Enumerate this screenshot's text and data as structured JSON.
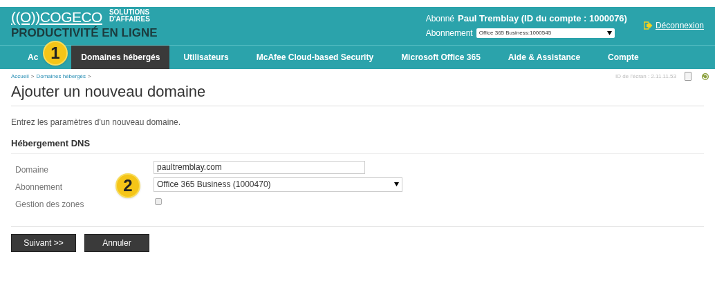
{
  "brand": {
    "logo": "((O))COGECO",
    "tagline_1": "SOLUTIONS",
    "tagline_2": "D'AFFAIRES",
    "product": "PRODUCTIVITÉ EN LIGNE"
  },
  "account": {
    "subscriber_label": "Abonné",
    "subscriber": "Paul Tremblay (ID du compte : 1000076)",
    "subscription_label": "Abonnement",
    "subscription": "Office 365 Business:1000545",
    "logout": "Déconnexion"
  },
  "nav": [
    {
      "label": "Ac",
      "selected": false
    },
    {
      "label": "Domaines hébergés",
      "selected": true
    },
    {
      "label": "Utilisateurs",
      "selected": false
    },
    {
      "label": "McAfee Cloud-based Security",
      "selected": false
    },
    {
      "label": "Microsoft Office 365",
      "selected": false
    },
    {
      "label": "Aide & Assistance",
      "selected": false
    },
    {
      "label": "Compte",
      "selected": false
    }
  ],
  "callouts": [
    "1",
    "2"
  ],
  "breadcrumb": [
    {
      "kind": "link",
      "text": "Accueil"
    },
    {
      "kind": "separator",
      "text": ">"
    },
    {
      "kind": "link",
      "text": "Domaines hébergés"
    },
    {
      "kind": "separator",
      "text": ">"
    }
  ],
  "screen_id": "ID de l'écran : 2.11.11.53",
  "page_title": "Ajouter un nouveau domaine",
  "intro": "Entrez les paramètres d'un nouveau domaine.",
  "section": "Hébergement DNS",
  "form": [
    {
      "kind": "text",
      "label": "Domaine",
      "value": "paultremblay.com"
    },
    {
      "kind": "select",
      "label": "Abonnement",
      "value": "Office 365 Business (1000470)"
    },
    {
      "kind": "checkbox",
      "label": "Gestion des zones",
      "checked": false
    }
  ],
  "buttons": [
    "Suivant >>",
    "Annuler"
  ]
}
